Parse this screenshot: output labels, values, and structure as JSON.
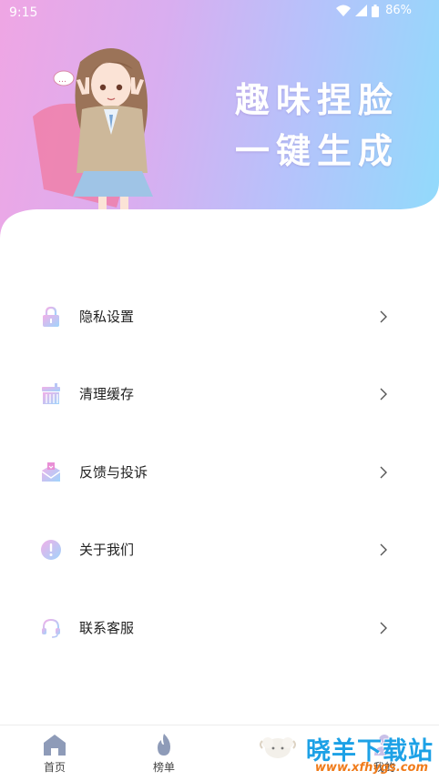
{
  "status_bar": {
    "time": "9:15",
    "battery": "86%"
  },
  "hero": {
    "slogan_line1": "趣味捏脸",
    "slogan_line2": "一键生成"
  },
  "menu": {
    "items": [
      {
        "label": "隐私设置",
        "icon": "lock-icon"
      },
      {
        "label": "清理缓存",
        "icon": "broom-icon"
      },
      {
        "label": "反馈与投诉",
        "icon": "mail-icon"
      },
      {
        "label": "关于我们",
        "icon": "info-icon"
      },
      {
        "label": "联系客服",
        "icon": "headset-icon"
      }
    ]
  },
  "tabbar": {
    "tabs": [
      {
        "label": "首页",
        "icon": "home-icon"
      },
      {
        "label": "榜单",
        "icon": "flame-icon"
      },
      {
        "label": "我的",
        "icon": "profile-icon"
      }
    ]
  },
  "watermark": {
    "main": "晓羊下载站",
    "url": "www.xfhygs.com"
  },
  "colors": {
    "hero_gradient_start": "#efa6e4",
    "hero_gradient_end": "#8fdcfb",
    "icon_gradient_start": "#f2b0e8",
    "icon_gradient_end": "#9fd4fb",
    "watermark_blue": "#1da1e6",
    "watermark_orange": "#f07b1a"
  }
}
